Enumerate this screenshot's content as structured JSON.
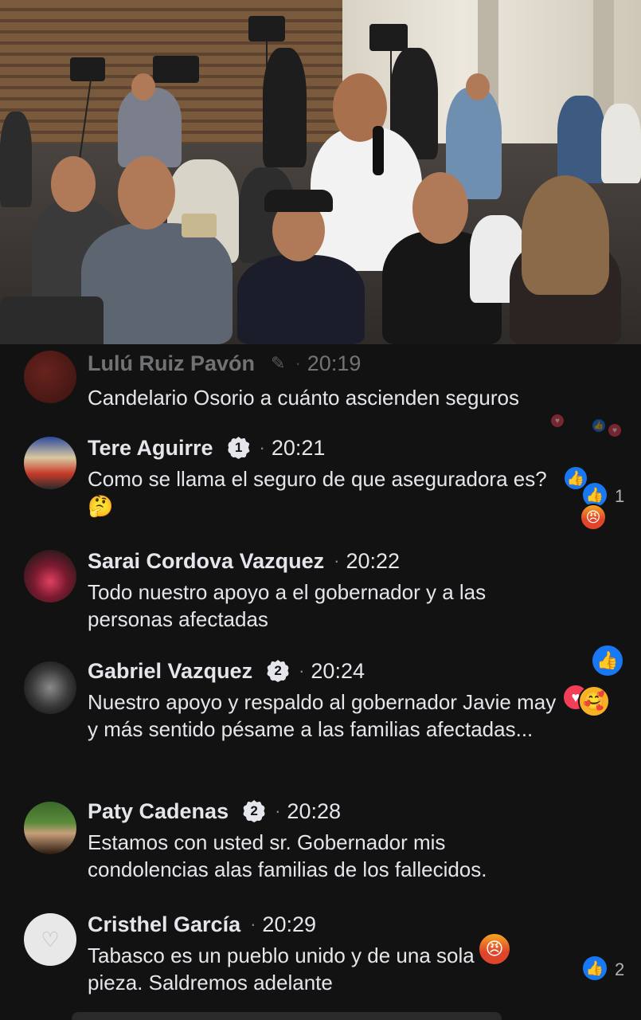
{
  "video": {
    "description_icon": "live-press-conference-video"
  },
  "comments": [
    {
      "name": "Lulú Ruiz Pavón",
      "badge": "",
      "time": "20:19",
      "text": "Candelario Osorio a cuánto ascienden seguros",
      "reactions": [
        "love-icon",
        "like-icon",
        "love-icon"
      ],
      "reaction_count": ""
    },
    {
      "name": "Tere Aguirre",
      "badge": "1",
      "time": "20:21",
      "text": "Como se llama el seguro de que aseguradora es?🤔",
      "reactions": [
        "like-icon",
        "angry-icon"
      ],
      "reaction_count": "1"
    },
    {
      "name": "Sarai Cordova Vazquez",
      "badge": "",
      "time": "20:22",
      "text": "Todo nuestro apoyo a el gobernador y a las personas afectadas",
      "reactions": [],
      "reaction_count": ""
    },
    {
      "name": "Gabriel Vazquez",
      "badge": "2",
      "time": "20:24",
      "text": "Nuestro apoyo y respaldo al gobernador  Javie may y más sentido pésame a las familias afectadas...",
      "reactions": [
        "like-icon",
        "love-icon",
        "care-icon"
      ],
      "reaction_count": ""
    },
    {
      "name": "Paty Cadenas",
      "badge": "2",
      "time": "20:28",
      "text": "Estamos con usted sr. Gobernador mis condolencias alas familias de los fallecidos.",
      "reactions": [],
      "reaction_count": ""
    },
    {
      "name": "Cristhel García",
      "badge": "",
      "time": "20:29",
      "text": "Tabasco es un pueblo unido y de una sola pieza. Saldremos adelante",
      "reactions": [
        "angry-icon",
        "like-icon"
      ],
      "reaction_count": "2"
    }
  ],
  "colors": {
    "background": "#121212",
    "text": "#e4e6eb",
    "meta": "#8a8d91",
    "like": "#1877f2",
    "love": "#f33e58"
  }
}
